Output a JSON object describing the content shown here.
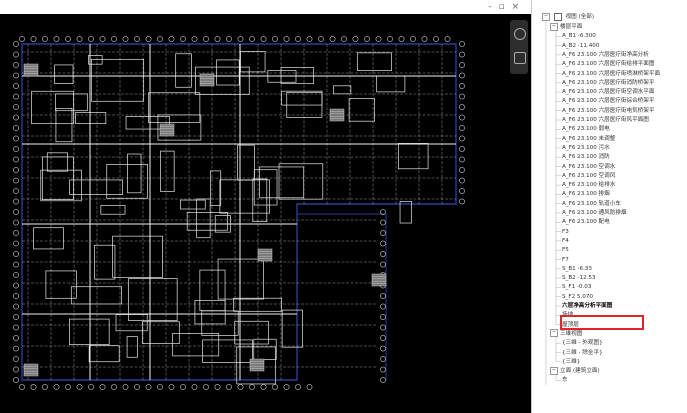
{
  "window": {
    "controls": "- ▫ ×"
  },
  "browser": {
    "root_label": "视图 (全部)",
    "groups": [
      {
        "label": "楼层平面",
        "items": [
          "A_B1 -6.300",
          "A_B2 -11.400",
          "A_F6 23.100 六层医疗街净高分析",
          "A_F6 23.100 六层医疗街给排平面图",
          "A_F6 23.100 六层医疗街喷淋桥架平面",
          "A_F6 23.100 六层医疗街消防桥架平",
          "A_F6 23.100 六层医疗街空调水平面",
          "A_F6 23.100 六层医疗街综合桥架平",
          "A_F6 23.100 六层医疗街电気桥架平",
          "A_F6 23.100 六层医疗街风平面图",
          "A_F6 23.100 弱电",
          "A_F6 23.100 未调整",
          "A_F6 23.100 污水",
          "A_F6 23.100 消防",
          "A_F6 23.100 空调水",
          "A_F6 23.100 空调风",
          "A_F6 23.100 给排水",
          "A_F6 23.100 排烟",
          "A_F6 23.100 轨道小车",
          "A_F6 23.100 通风防排烟",
          "A_F6 23.100 配电",
          "F3",
          "F4",
          "F5",
          "F7",
          "S_B1 -6.33",
          "S_B2 -12.53",
          "S_F1 -0.03",
          "S_F2 5.070",
          "六层净高分析平面图",
          "场地",
          "屋顶层"
        ]
      },
      {
        "label": "三维视图",
        "items": [
          "{三维 - 外观图}",
          "{三维 - 除全平}",
          "{三维}"
        ]
      },
      {
        "label": "立面 (建筑立面)",
        "items": [
          "东"
        ]
      }
    ],
    "highlighted_item": "六层净高分析平面图"
  },
  "colors": {
    "viewport_bg": "#000000",
    "highlight": "#e0262c",
    "outline": "#2a3a9a"
  }
}
